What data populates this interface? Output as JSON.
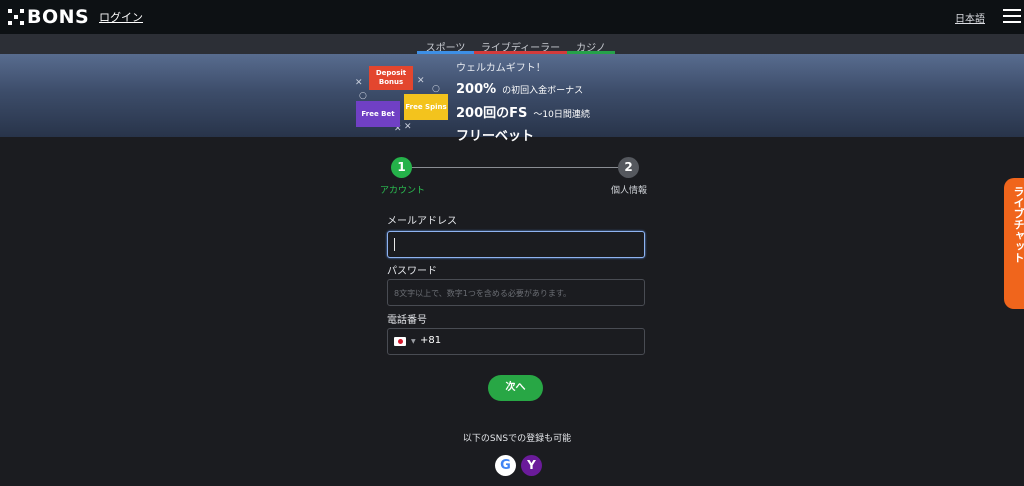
{
  "header": {
    "logo_text": "BONS",
    "login_label": "ログイン",
    "language_label": "日本語",
    "menu_icon": "hamburger-menu-icon"
  },
  "tabs": [
    {
      "label": "スポーツ",
      "underline_color": "#3d8fe6"
    },
    {
      "label": "ライブディーラー",
      "underline_color": "#d33b3b"
    },
    {
      "label": "カジノ",
      "underline_color": "#25a24a"
    }
  ],
  "banner": {
    "chips": {
      "deposit_bonus": "Deposit Bonus",
      "free_bet": "Free Bet",
      "free_spins": "Free Spins"
    },
    "line1": "ウェルカムギフト！",
    "line2_big": "200%",
    "line2_small": "の初回入金ボーナス",
    "line3_big": "200回のFS",
    "line3_small": "〜10日間連続",
    "line4": "フリーベット"
  },
  "stepper": {
    "step1_number": "1",
    "step1_label": "アカウント",
    "step2_number": "2",
    "step2_label": "個人情報"
  },
  "form": {
    "email_label": "メールアドレス",
    "email_value": "",
    "password_label": "パスワード",
    "password_placeholder": "8文字以上で、数字1つを含める必要があります。",
    "phone_label": "電話番号",
    "phone_country_flag": "japan-flag-icon",
    "phone_dial_code": "+81"
  },
  "next_button_label": "次へ",
  "sns": {
    "caption": "以下のSNSでの登録も可能",
    "google_icon_glyph": "G",
    "yahoo_icon_glyph": "Y"
  },
  "livechat_label": "ライブチャット",
  "colors": {
    "accent_green": "#28a745",
    "livechat_orange": "#f0651c"
  }
}
